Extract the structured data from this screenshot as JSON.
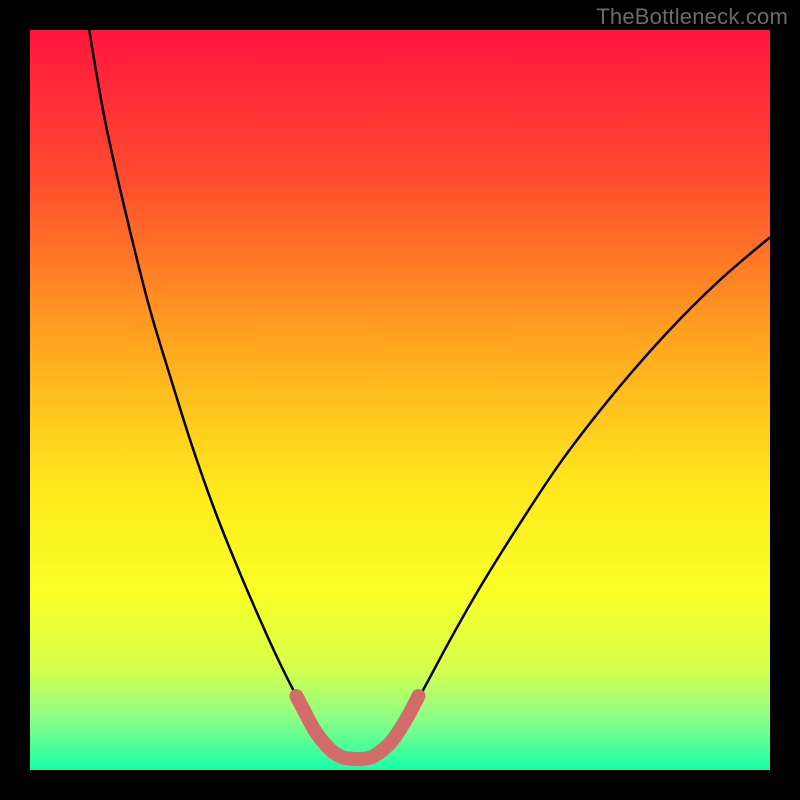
{
  "watermark": "TheBottleneck.com",
  "chart_data": {
    "type": "line",
    "title": "",
    "xlabel": "",
    "ylabel": "",
    "xlim": [
      0,
      100
    ],
    "ylim": [
      0,
      100
    ],
    "gradient_stops": [
      {
        "offset": 0,
        "color": "#ff163f"
      },
      {
        "offset": 20,
        "color": "#ff4b2e"
      },
      {
        "offset": 42,
        "color": "#ffa51f"
      },
      {
        "offset": 62,
        "color": "#ffe91d"
      },
      {
        "offset": 76,
        "color": "#f8ff26"
      },
      {
        "offset": 86,
        "color": "#d7ff4a"
      },
      {
        "offset": 93,
        "color": "#8cff86"
      },
      {
        "offset": 100,
        "color": "#17ffa8"
      }
    ],
    "series": [
      {
        "name": "left-curve",
        "color": "#000000",
        "width": 2.5,
        "points": [
          {
            "x": 8.0,
            "y": 100.0
          },
          {
            "x": 9.0,
            "y": 94.0
          },
          {
            "x": 10.5,
            "y": 86.0
          },
          {
            "x": 13.0,
            "y": 75.0
          },
          {
            "x": 16.0,
            "y": 63.0
          },
          {
            "x": 19.0,
            "y": 53.0
          },
          {
            "x": 22.0,
            "y": 43.5
          },
          {
            "x": 25.0,
            "y": 35.0
          },
          {
            "x": 28.0,
            "y": 27.5
          },
          {
            "x": 31.0,
            "y": 20.5
          },
          {
            "x": 33.5,
            "y": 15.0
          },
          {
            "x": 36.0,
            "y": 10.0
          },
          {
            "x": 38.0,
            "y": 6.5
          },
          {
            "x": 39.5,
            "y": 4.0
          }
        ]
      },
      {
        "name": "right-curve",
        "color": "#000000",
        "width": 2.5,
        "points": [
          {
            "x": 49.0,
            "y": 4.0
          },
          {
            "x": 51.0,
            "y": 7.0
          },
          {
            "x": 53.5,
            "y": 11.5
          },
          {
            "x": 57.0,
            "y": 18.0
          },
          {
            "x": 61.0,
            "y": 25.0
          },
          {
            "x": 66.0,
            "y": 33.0
          },
          {
            "x": 72.0,
            "y": 42.0
          },
          {
            "x": 79.0,
            "y": 51.0
          },
          {
            "x": 86.0,
            "y": 59.0
          },
          {
            "x": 93.0,
            "y": 66.0
          },
          {
            "x": 100.0,
            "y": 72.0
          }
        ]
      },
      {
        "name": "valley-marker",
        "color": "#d36b6b",
        "width": 14,
        "linecap": "round",
        "points": [
          {
            "x": 36.0,
            "y": 10.0
          },
          {
            "x": 37.3,
            "y": 7.5
          },
          {
            "x": 38.5,
            "y": 5.3
          },
          {
            "x": 39.8,
            "y": 3.6
          },
          {
            "x": 41.0,
            "y": 2.4
          },
          {
            "x": 42.3,
            "y": 1.7
          },
          {
            "x": 43.7,
            "y": 1.5
          },
          {
            "x": 45.0,
            "y": 1.5
          },
          {
            "x": 46.3,
            "y": 1.8
          },
          {
            "x": 47.5,
            "y": 2.6
          },
          {
            "x": 48.8,
            "y": 3.8
          },
          {
            "x": 50.0,
            "y": 5.5
          },
          {
            "x": 51.2,
            "y": 7.5
          },
          {
            "x": 52.5,
            "y": 10.0
          }
        ]
      }
    ]
  }
}
